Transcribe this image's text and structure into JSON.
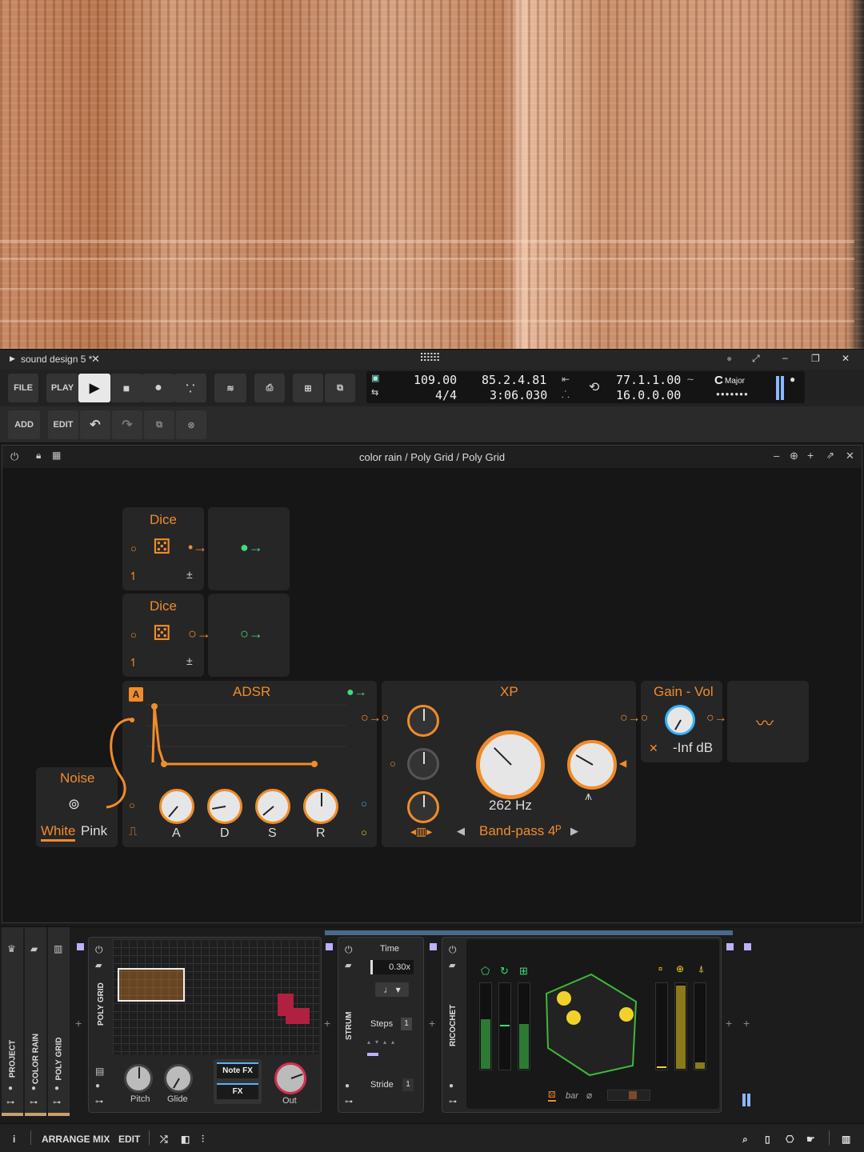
{
  "window": {
    "tab_title": "sound design 5 *"
  },
  "transport": {
    "file_label": "FILE",
    "play_label": "PLAY",
    "tempo": "109.00",
    "time_signature": "4/4",
    "position_beats": "85.2.4.81",
    "position_time": "3:06.030",
    "loop_start": "77.1.1.00",
    "loop_length": "16.0.0.00",
    "key_root": "C",
    "key_scale": "Major"
  },
  "toolbar": {
    "add_label": "ADD",
    "edit_label": "EDIT"
  },
  "device": {
    "breadcrumb": "color rain / Poly Grid / Poly Grid",
    "dice1_title": "Dice",
    "dice2_title": "Dice",
    "adsr_title": "ADSR",
    "adsr_badge": "A",
    "adsr_knobs": [
      "A",
      "D",
      "S",
      "R"
    ],
    "xp_title": "XP",
    "xp_freq": "262 Hz",
    "xp_mode": "Band-pass 4ᴾ",
    "gain_title": "Gain - Vol",
    "gain_value": "-Inf dB",
    "noise_title": "Noise",
    "noise_white": "White",
    "noise_pink": "Pink"
  },
  "chain": {
    "tabs": [
      "PROJECT",
      "COLOR RAIN",
      "POLY GRID"
    ],
    "polygrid_label": "POLY GRID",
    "pitch_label": "Pitch",
    "glide_label": "Glide",
    "note_fx_label": "Note FX",
    "fx_label": "FX",
    "out_label": "Out",
    "strum_label": "STRUM",
    "time_label": "Time",
    "time_value": "0.30x",
    "steps_label": "Steps",
    "steps_value": "1",
    "stride_label": "Stride",
    "stride_value": "1",
    "ricochet_label": "RICOCHET",
    "bar_label": "bar"
  },
  "footer": {
    "info": "i",
    "arrange": "ARRANGE",
    "mix": "MIX",
    "edit": "EDIT"
  },
  "colors": {
    "accent": "#f08c2a",
    "green": "#3fdc78",
    "yellow": "#f2d22a"
  }
}
